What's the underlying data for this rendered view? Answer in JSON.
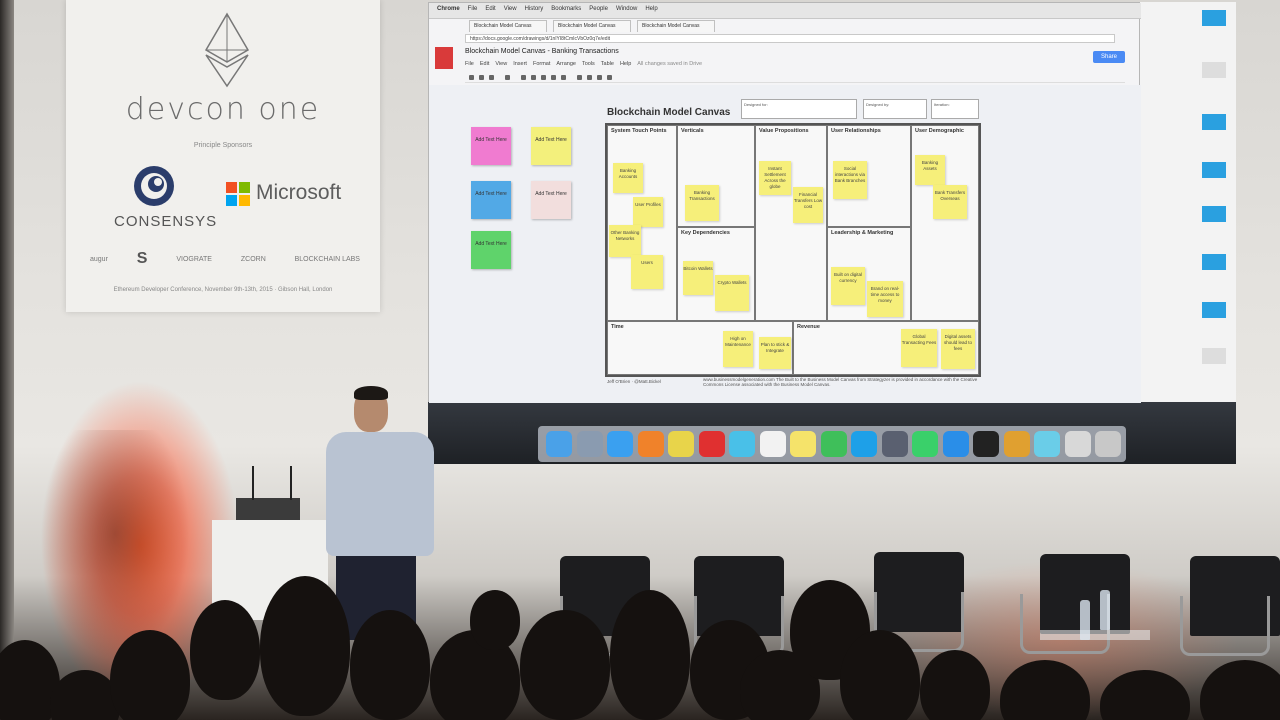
{
  "sponsor_board": {
    "title": "devcon one",
    "sponsors_label": "Principle Sponsors",
    "consensys": "CONSENSYS",
    "microsoft": "Microsoft",
    "small_logos": [
      "augur",
      "S",
      "VIOGRATE",
      "ZCORN",
      "BLOCKCHAIN LABS"
    ],
    "footer": "Ethereum Developer Conference, November 9th-13th, 2015 · Gibson Hall, London"
  },
  "browser": {
    "app_menu": [
      "Chrome",
      "File",
      "Edit",
      "View",
      "History",
      "Bookmarks",
      "People",
      "Window",
      "Help"
    ],
    "tabs": [
      "Blockchain Model Canvas",
      "Blockchain Model Canvas",
      "Blockchain Model Canvas"
    ],
    "url": "https://docs.google.com/drawings/d/1nlYI8tCmIcVbOz0q7e/edit",
    "doc_title": "Blockchain Model Canvas - Banking Transactions",
    "doc_menu": [
      "File",
      "Edit",
      "View",
      "Insert",
      "Format",
      "Arrange",
      "Tools",
      "Table",
      "Help",
      "All changes saved in Drive"
    ],
    "share_label": "Share"
  },
  "canvas": {
    "title": "Blockchain Model Canvas",
    "meta_boxes": [
      "Designed for:",
      "Designed by:",
      "Iteration:"
    ],
    "side_notes": [
      {
        "text": "Add Text Here",
        "color": "#f07bd0"
      },
      {
        "text": "Add Text Here",
        "color": "#f3f07c"
      },
      {
        "text": "Add Text Here",
        "color": "#52a9e6"
      },
      {
        "text": "Add Text Here",
        "color": "#f2dedd"
      },
      {
        "text": "Add Text Here",
        "color": "#5fd36b"
      }
    ],
    "sections": [
      {
        "title": "System Touch Points"
      },
      {
        "title": "Verticals"
      },
      {
        "title": "Value Propositions"
      },
      {
        "title": "User Relationships"
      },
      {
        "title": "User Demographic"
      },
      {
        "title": "Key Dependencies"
      },
      {
        "title": "Leadership & Marketing"
      },
      {
        "title": "Time"
      },
      {
        "title": "Revenue"
      }
    ],
    "stickies": [
      "Banking Accounts",
      "User Profiles",
      "Other Banking Networks",
      "Users",
      "Banking Transactions",
      "Instant Settlement Across the globe",
      "Financial Transfers Low cost",
      "Social interactions via Bank Branches",
      "Banking Assets",
      "Bank Transfers Overseas",
      "Bitcoin Wallets",
      "Crypto Wallets",
      "Built on digital currency",
      "Brand on real-time access to money",
      "High on Maintenance",
      "Plan to stick & Integrate",
      "Global Transacting Fees",
      "Digital assets should lead to fees"
    ],
    "footnote": "Jeff O'Brien · @Matt.Bickel",
    "footnote2": "www.businessmodelgeneration.com The Built to the Business Model Canvas from Strategyzer is provided in accordance with the Creative Commons License associated with the Business Model Canvas."
  },
  "dock": {
    "icons": [
      {
        "name": "finder-icon",
        "color": "#4aa1e8"
      },
      {
        "name": "launchpad-icon",
        "color": "#8a9bb0"
      },
      {
        "name": "safari-icon",
        "color": "#3aa0f0"
      },
      {
        "name": "firefox-icon",
        "color": "#f0822a"
      },
      {
        "name": "chrome-icon",
        "color": "#e8d44a"
      },
      {
        "name": "opera-icon",
        "color": "#e03030"
      },
      {
        "name": "messages-icon",
        "color": "#49c0e8"
      },
      {
        "name": "calendar-icon",
        "color": "#f2f2f2"
      },
      {
        "name": "notes-icon",
        "color": "#f5e36a"
      },
      {
        "name": "facetime-icon",
        "color": "#3fbf5a"
      },
      {
        "name": "skype-icon",
        "color": "#1ea0e8"
      },
      {
        "name": "quicktime-icon",
        "color": "#5a6070"
      },
      {
        "name": "sublime-icon",
        "color": "#3ad06a"
      },
      {
        "name": "app-store-icon",
        "color": "#2a8ee8"
      },
      {
        "name": "terminal-icon",
        "color": "#222222"
      },
      {
        "name": "photos-icon",
        "color": "#e0a030"
      },
      {
        "name": "preview-icon",
        "color": "#6acde8"
      },
      {
        "name": "lock-icon",
        "color": "#d8d8d8"
      },
      {
        "name": "trash-icon",
        "color": "#c8c8c8"
      }
    ]
  }
}
